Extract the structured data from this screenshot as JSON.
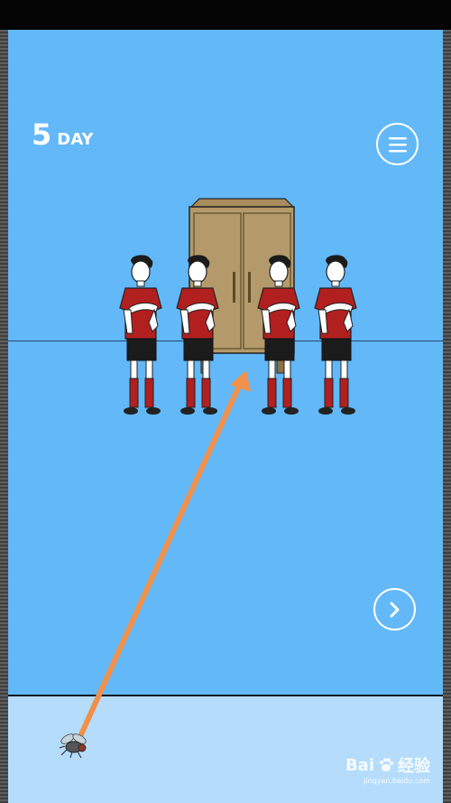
{
  "hud": {
    "day_number": "5",
    "day_label": "DAY"
  },
  "icons": {
    "menu": "hamburger-menu-icon",
    "next": "chevron-right-icon"
  },
  "scene": {
    "objects": [
      "wardrobe",
      "player-1",
      "player-2",
      "player-3",
      "player-4"
    ],
    "jersey_color": "#b21f1f",
    "shorts_color": "#1b1b1b",
    "wardrobe_color": "#b49a6a"
  },
  "inventory": {
    "item": "fly"
  },
  "hint_arrow": {
    "from": "fly",
    "to": "wardrobe",
    "color": "#f0904a"
  },
  "colors": {
    "sky": "#63b8f8",
    "tray": "#b5ddfb"
  },
  "watermark": {
    "brand_left": "Bai",
    "brand_right": "经验",
    "sub": "jingyan.baidu.com"
  }
}
